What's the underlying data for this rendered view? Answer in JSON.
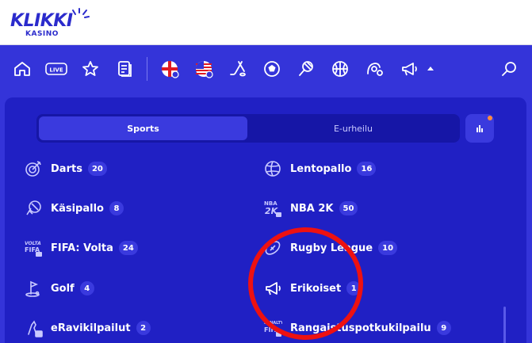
{
  "brand": {
    "name": "KLIKKI",
    "sub": "KASINO",
    "color": "#2b2bcc"
  },
  "nav": {
    "icons": [
      "home-icon",
      "live-icon",
      "star-icon",
      "betslip-icon",
      "england-flag-icon",
      "usa-flag-icon",
      "hockey-icon",
      "football-icon",
      "tennis-icon",
      "basketball-icon",
      "trotting-icon",
      "specials-icon",
      "search-icon"
    ],
    "live_label": "LIVE"
  },
  "tabs": {
    "sports": "Sports",
    "esports": "E-urheilu"
  },
  "sports_left": [
    {
      "icon": "darts-icon",
      "label": "Darts",
      "count": "20"
    },
    {
      "icon": "handball-icon",
      "label": "Käsipallo",
      "count": "8"
    },
    {
      "icon": "fifa-volta-icon",
      "label": "FIFA: Volta",
      "count": "24"
    },
    {
      "icon": "golf-icon",
      "label": "Golf",
      "count": "4"
    },
    {
      "icon": "virtual-trotting-icon",
      "label": "eRavikilpailut",
      "count": "2"
    }
  ],
  "sports_right": [
    {
      "icon": "volleyball-icon",
      "label": "Lentopallo",
      "count": "16"
    },
    {
      "icon": "nba2k-icon",
      "label": "NBA 2K",
      "count": "50"
    },
    {
      "icon": "rugby-icon",
      "label": "Rugby League",
      "count": "10"
    },
    {
      "icon": "megaphone-icon",
      "label": "Erikoiset",
      "count": "1"
    },
    {
      "icon": "fifa-penalty-icon",
      "label": "Rangaistuspotkukilpailu",
      "count": "9"
    }
  ],
  "colors": {
    "nav": "#3434d9",
    "panel": "#2020c4",
    "highlight": "#ee1111",
    "notification": "#ff8a3d"
  }
}
